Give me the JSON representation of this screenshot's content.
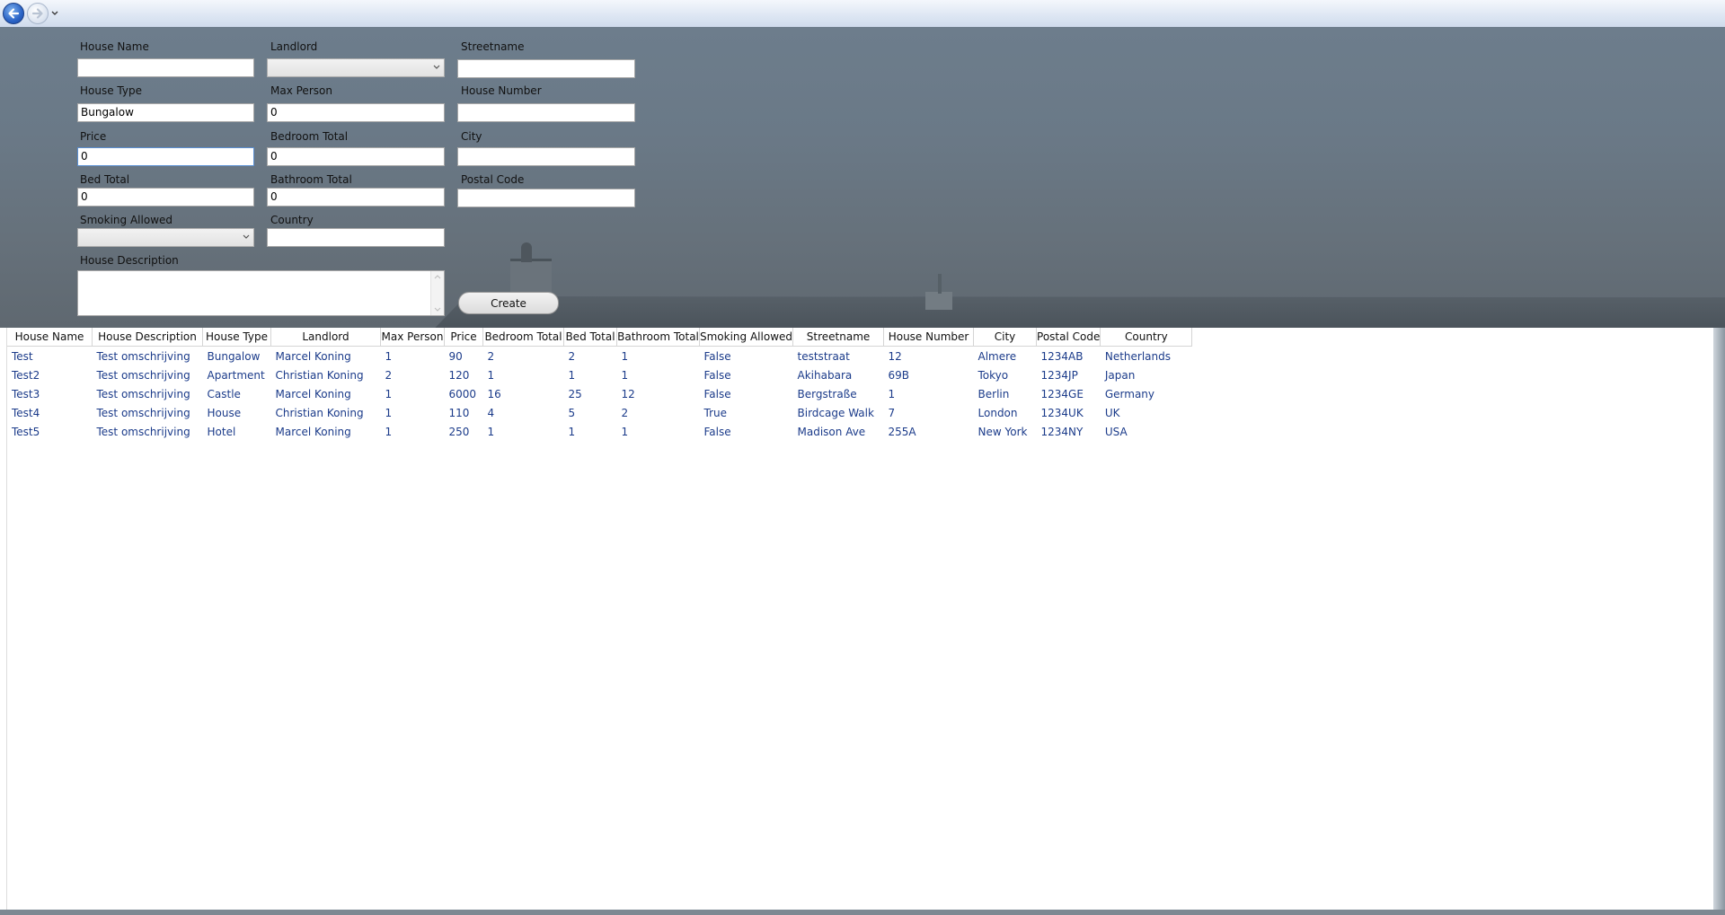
{
  "nav": {
    "back_icon": "back-arrow-icon",
    "forward_icon": "forward-arrow-icon",
    "history_icon": "chevron-down-icon"
  },
  "form": {
    "house_name": {
      "label": "House Name",
      "value": ""
    },
    "landlord": {
      "label": "Landlord",
      "value": ""
    },
    "streetname": {
      "label": "Streetname",
      "value": ""
    },
    "house_type": {
      "label": "House Type",
      "value": "Bungalow"
    },
    "max_person": {
      "label": "Max Person",
      "value": "0"
    },
    "house_number": {
      "label": "House Number",
      "value": ""
    },
    "price": {
      "label": "Price",
      "value": "0"
    },
    "bedroom_total": {
      "label": "Bedroom Total",
      "value": "0"
    },
    "city": {
      "label": "City",
      "value": ""
    },
    "bed_total": {
      "label": "Bed Total",
      "value": "0"
    },
    "bathroom_total": {
      "label": "Bathroom Total",
      "value": "0"
    },
    "postal_code": {
      "label": "Postal Code",
      "value": ""
    },
    "smoking_allowed": {
      "label": "Smoking Allowed",
      "value": ""
    },
    "country": {
      "label": "Country",
      "value": ""
    },
    "house_description": {
      "label": "House Description",
      "value": ""
    },
    "create_label": "Create"
  },
  "grid": {
    "columns": [
      "House Name",
      "House Description",
      "House Type",
      "Landlord",
      "Max Person",
      "Price",
      "Bedroom Total",
      "Bed Total",
      "Bathroom Total",
      "Smoking Allowed",
      "Streetname",
      "House Number",
      "City",
      "Postal Code",
      "Country"
    ],
    "rows": [
      [
        "Test",
        "Test omschrijving",
        "Bungalow",
        "Marcel Koning",
        "1",
        "90",
        "2",
        "2",
        "1",
        "False",
        "teststraat",
        "12",
        "Almere",
        "1234AB",
        "Netherlands"
      ],
      [
        "Test2",
        "Test omschrijving",
        "Apartment",
        "Christian Koning",
        "2",
        "120",
        "1",
        "1",
        "1",
        "False",
        "Akihabara",
        "69B",
        "Tokyo",
        "1234JP",
        "Japan"
      ],
      [
        "Test3",
        "Test omschrijving",
        "Castle",
        "Marcel Koning",
        "1",
        "6000",
        "16",
        "25",
        "12",
        "False",
        "Bergstraße",
        "1",
        "Berlin",
        "1234GE",
        "Germany"
      ],
      [
        "Test4",
        "Test omschrijving",
        "House",
        "Christian Koning",
        "1",
        "110",
        "4",
        "5",
        "2",
        "True",
        "Birdcage Walk",
        "7",
        "London",
        "1234UK",
        "UK"
      ],
      [
        "Test5",
        "Test omschrijving",
        "Hotel",
        "Marcel Koning",
        "1",
        "250",
        "1",
        "1",
        "1",
        "False",
        "Madison Ave",
        "255A",
        "New York",
        "1234NY",
        "USA"
      ]
    ]
  },
  "colors": {
    "cell_text": "#1b3b8a",
    "focus_border": "#5b8fd2"
  }
}
